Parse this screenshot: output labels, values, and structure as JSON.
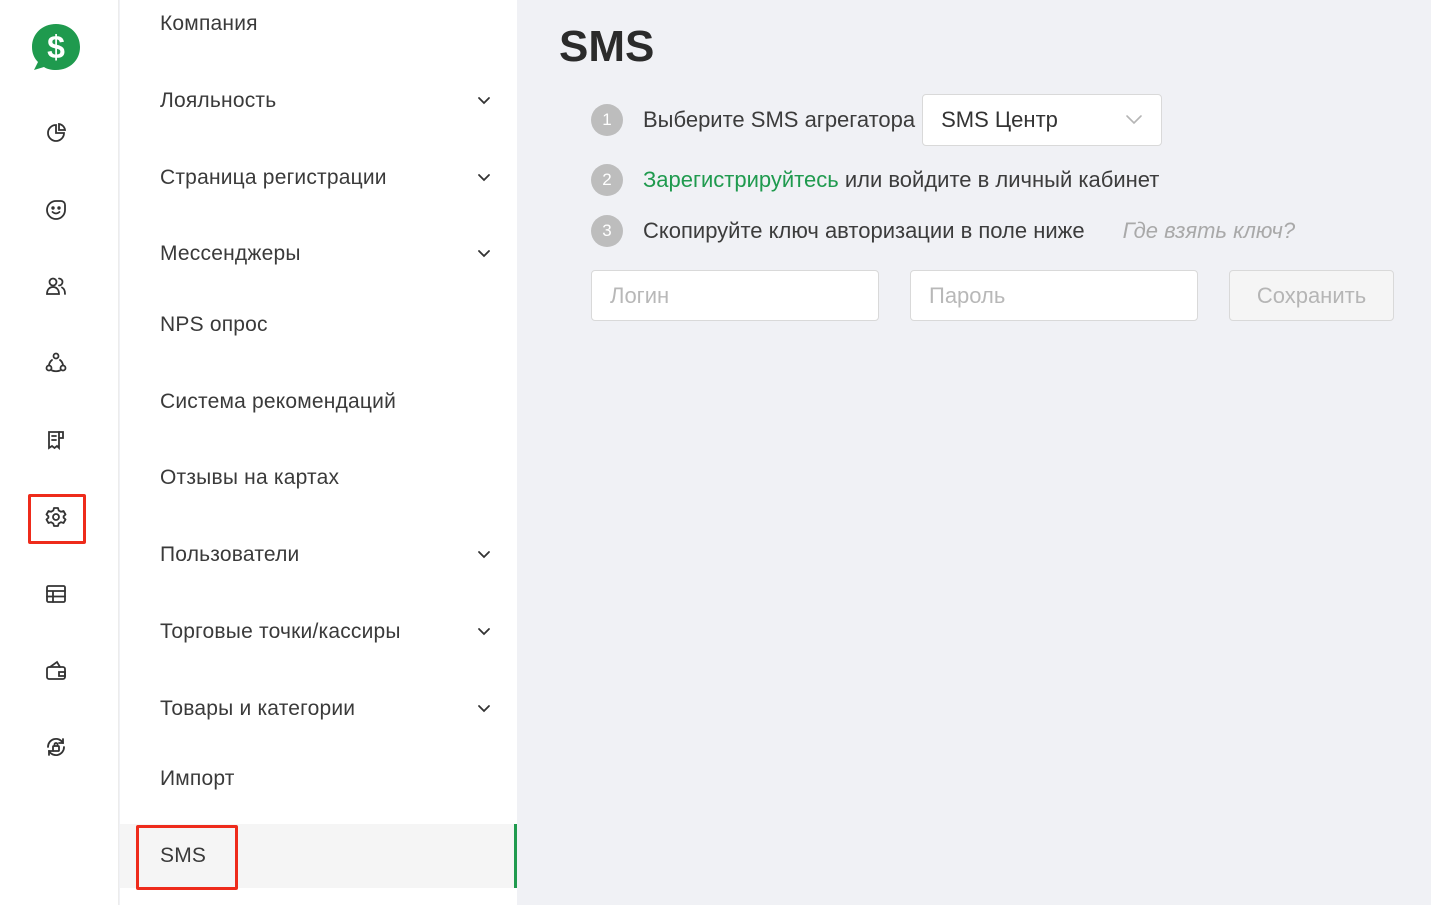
{
  "page": {
    "title": "SMS"
  },
  "rail": {
    "icons": [
      "dollar-logo-icon",
      "pie-chart-icon",
      "smile-icon",
      "users-icon",
      "network-icon",
      "receipt-icon",
      "gear-icon",
      "table-icon",
      "wallet-icon",
      "lock-refresh-icon"
    ],
    "selected": "gear-icon"
  },
  "menu": {
    "items": [
      {
        "label": "Компания",
        "has_children": false
      },
      {
        "label": "Лояльность",
        "has_children": true
      },
      {
        "label": "Страница регистрации",
        "has_children": true
      },
      {
        "label": "Мессенджеры",
        "has_children": true
      },
      {
        "label": "NPS опрос",
        "has_children": false
      },
      {
        "label": "Система рекомендаций",
        "has_children": false
      },
      {
        "label": "Отзывы на картах",
        "has_children": false
      },
      {
        "label": "Пользователи",
        "has_children": true
      },
      {
        "label": "Торговые точки/кассиры",
        "has_children": true
      },
      {
        "label": "Товары и категории",
        "has_children": true
      },
      {
        "label": "Импорт",
        "has_children": false
      },
      {
        "label": "SMS",
        "has_children": false,
        "active": true
      }
    ]
  },
  "steps": {
    "one": {
      "num": "1",
      "text": "Выберите SMS агрегатора",
      "select_value": "SMS Центр"
    },
    "two": {
      "num": "2",
      "link": "Зарегистрируйтесь",
      "text": " или войдите в личный кабинет"
    },
    "three": {
      "num": "3",
      "text": "Скопируйте ключ авторизации в поле ниже",
      "help": "Где взять ключ?"
    }
  },
  "form": {
    "login_placeholder": "Логин",
    "password_placeholder": "Пароль",
    "save_label": "Сохранить"
  },
  "colors": {
    "accent": "#1f9a4e",
    "highlight": "#ee2b1b",
    "background": "#f0f1f5"
  }
}
